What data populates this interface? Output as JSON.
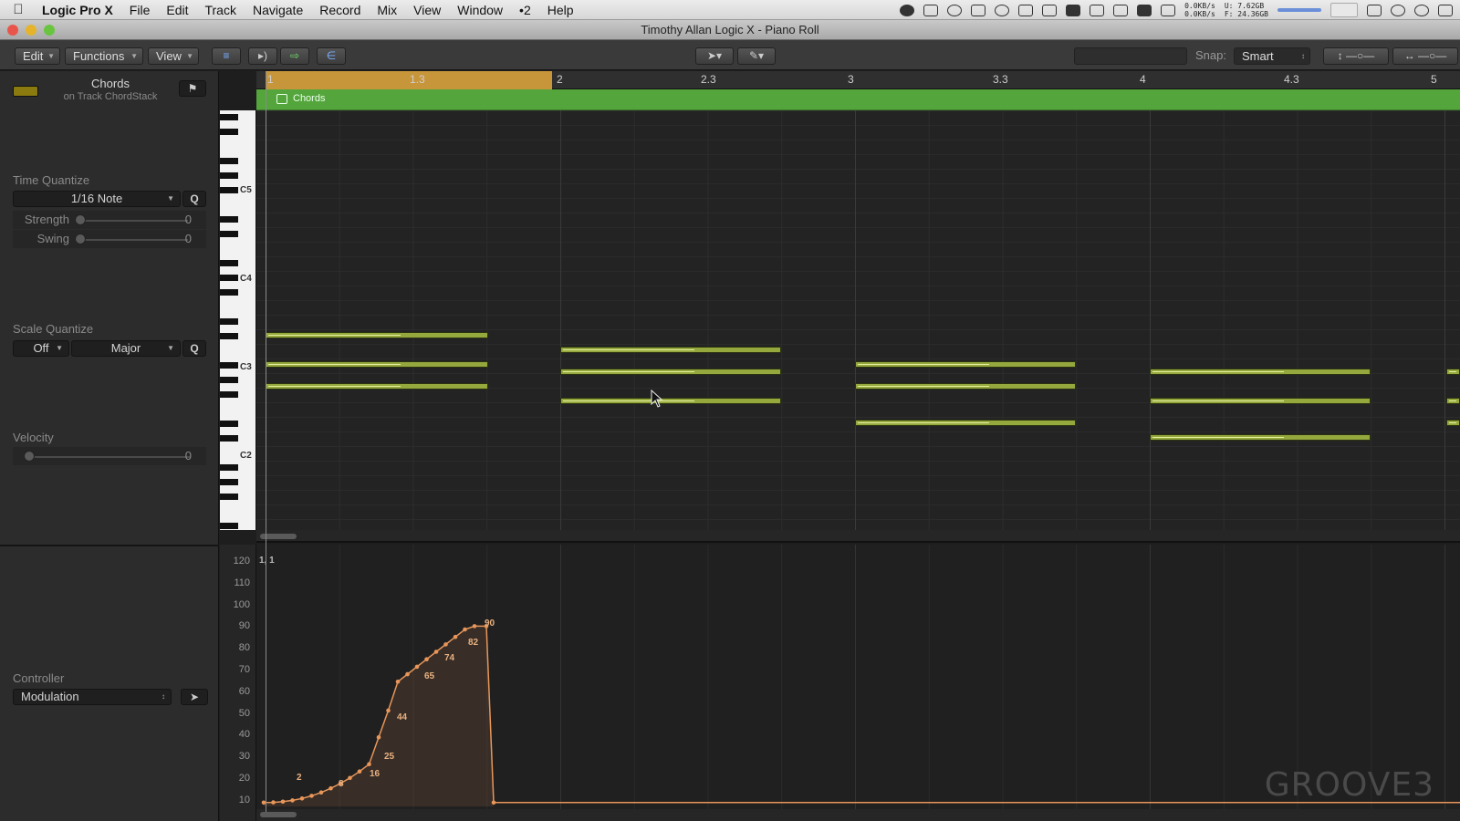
{
  "menubar": {
    "app": "Logic Pro X",
    "items": [
      "File",
      "Edit",
      "Track",
      "Navigate",
      "Record",
      "Mix",
      "View",
      "Window",
      "•2",
      "Help"
    ],
    "net_up": "0.0KB/s",
    "net_down": "0.0KB/s",
    "mem_used": "U: 7.62GB",
    "mem_free": "F: 24.36GB"
  },
  "window": {
    "title": "Timothy Allan Logic X - Piano Roll"
  },
  "toolbar": {
    "edit": "Edit",
    "functions": "Functions",
    "view": "View",
    "snap_label": "Snap:",
    "snap_value": "Smart"
  },
  "inspector": {
    "region_name": "Chords",
    "region_sub": "on Track ChordStack",
    "time_quantize_label": "Time Quantize",
    "time_quantize_value": "1/16 Note",
    "q": "Q",
    "strength_label": "Strength",
    "strength_value": "0",
    "swing_label": "Swing",
    "swing_value": "0",
    "scale_quantize_label": "Scale Quantize",
    "scale_off": "Off",
    "scale_mode": "Major",
    "velocity_label": "Velocity",
    "velocity_value": "0",
    "controller_label": "Controller",
    "controller_value": "Modulation"
  },
  "keyboard": {
    "labels": [
      "C5",
      "C4",
      "C3",
      "C2"
    ]
  },
  "ruler": {
    "marks": [
      "1",
      "1.3",
      "2",
      "2.3",
      "3",
      "3.3",
      "4",
      "4.3",
      "5"
    ]
  },
  "region": {
    "name": "Chords"
  },
  "controller": {
    "position": "1, 1",
    "y_ticks": [
      "120",
      "110",
      "100",
      "90",
      "80",
      "70",
      "60",
      "50",
      "40",
      "30",
      "20",
      "10"
    ],
    "point_labels": [
      "2",
      "8",
      "16",
      "25",
      "44",
      "65",
      "74",
      "82",
      "90"
    ]
  },
  "watermark": "GROOVE3",
  "colors": {
    "region": "#54a53c",
    "note": "#94a83e",
    "cycle": "#c8963a",
    "automation": "#e8965a"
  }
}
